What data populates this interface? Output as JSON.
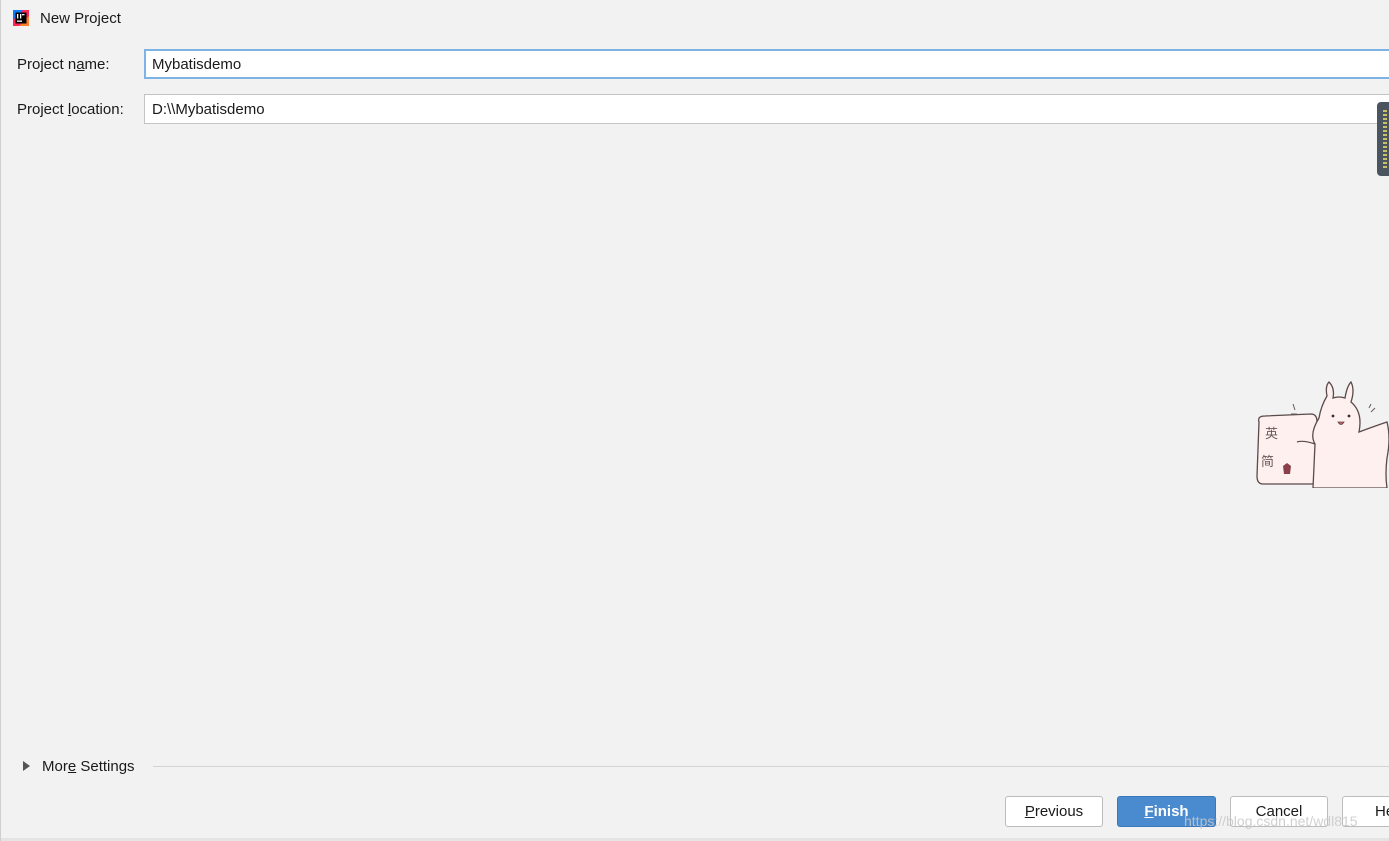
{
  "window": {
    "title": "New Project",
    "app_icon": "intellij-idea-icon"
  },
  "form": {
    "project_name": {
      "label_before": "Project n",
      "label_mnemonic": "a",
      "label_after": "me:",
      "value": "Mybatisdemo"
    },
    "project_location": {
      "label_before": "Project ",
      "label_mnemonic": "l",
      "label_after": "ocation:",
      "value": "D:\\\\Mybatisdemo"
    }
  },
  "more_settings": {
    "label_before": "Mor",
    "label_mnemonic": "e",
    "label_after": " Settings",
    "expanded": false
  },
  "buttons": {
    "previous": {
      "mnemonic": "P",
      "rest": "revious"
    },
    "finish": {
      "mnemonic": "F",
      "rest": "inish"
    },
    "cancel": {
      "label": "Cancel"
    },
    "help": {
      "label": "He"
    }
  },
  "overlay": {
    "mascot_glyph_top": "英",
    "mascot_glyph_bottom": "简",
    "watermark": "https://blog.csdn.net/wdl815"
  },
  "colors": {
    "background": "#f2f2f2",
    "focus_border": "#7eb3e6",
    "primary_button": "#4a8bd0"
  }
}
